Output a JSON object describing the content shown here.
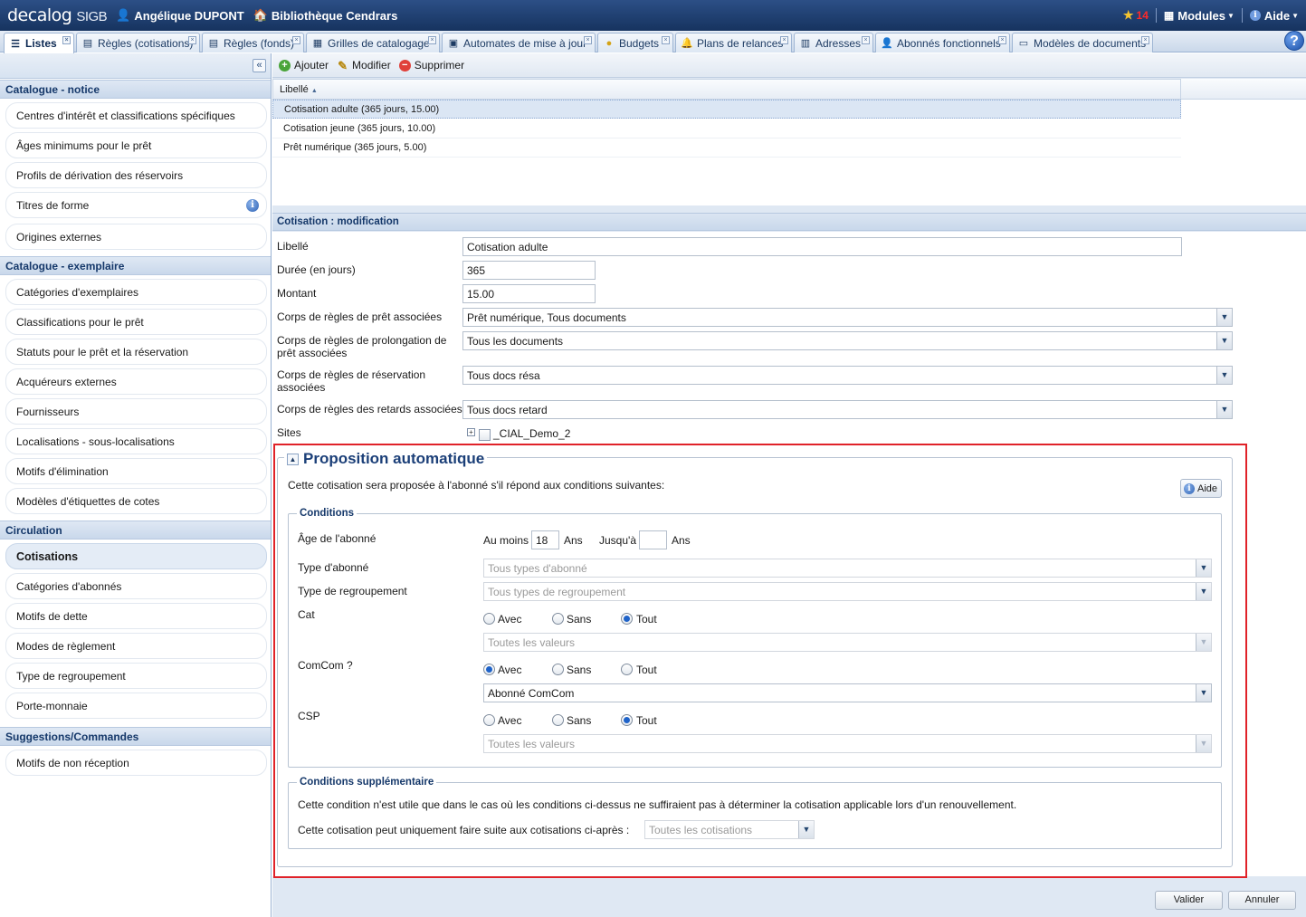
{
  "app": {
    "logo": "decalog",
    "product": "SIGB"
  },
  "user": {
    "name": "Angélique DUPONT",
    "library": "Bibliothèque Cendrars"
  },
  "topright": {
    "notifications": "14",
    "modules": "Modules",
    "aide": "Aide"
  },
  "tabs": [
    {
      "label": "Listes"
    },
    {
      "label": "Règles (cotisations)"
    },
    {
      "label": "Règles (fonds)"
    },
    {
      "label": "Grilles de catalogage"
    },
    {
      "label": "Automates de mise à jour"
    },
    {
      "label": "Budgets"
    },
    {
      "label": "Plans de relances"
    },
    {
      "label": "Adresses"
    },
    {
      "label": "Abonnés fonctionnels"
    },
    {
      "label": "Modèles de documents"
    }
  ],
  "sidebar": {
    "sections": [
      {
        "title": "Catalogue - notice",
        "items": [
          "Centres d'intérêt et classifications spécifiques",
          "Âges minimums pour le prêt",
          "Profils de dérivation des réservoirs",
          "Titres de forme",
          "Origines externes"
        ]
      },
      {
        "title": "Catalogue - exemplaire",
        "items": [
          "Catégories d'exemplaires",
          "Classifications pour le prêt",
          "Statuts pour le prêt et la réservation",
          "Acquéreurs externes",
          "Fournisseurs",
          "Localisations - sous-localisations",
          "Motifs d'élimination",
          "Modèles d'étiquettes de cotes"
        ]
      },
      {
        "title": "Circulation",
        "items": [
          "Cotisations",
          "Catégories d'abonnés",
          "Motifs de dette",
          "Modes de règlement",
          "Type de regroupement",
          "Porte-monnaie"
        ]
      },
      {
        "title": "Suggestions/Commandes",
        "items": [
          "Motifs de non réception"
        ]
      }
    ],
    "selected": "Cotisations"
  },
  "toolbar": {
    "add": "Ajouter",
    "edit": "Modifier",
    "delete": "Supprimer"
  },
  "grid": {
    "column": "Libellé",
    "rows": [
      "Cotisation adulte (365 jours, 15.00)",
      "Cotisation jeune (365 jours, 10.00)",
      "Prêt numérique (365 jours, 5.00)"
    ]
  },
  "form": {
    "title": "Cotisation : modification",
    "libelle_label": "Libellé",
    "libelle_value": "Cotisation adulte",
    "duree_label": "Durée (en jours)",
    "duree_value": "365",
    "montant_label": "Montant",
    "montant_value": "15.00",
    "pret_label": "Corps de règles de prêt associées",
    "pret_value": "Prêt numérique, Tous documents",
    "prolong_label_1": "Corps de règles de prolongation de",
    "prolong_label_2": "prêt associées",
    "prolong_value": "Tous les documents",
    "resa_label_1": "Corps de règles de réservation",
    "resa_label_2": "associées",
    "resa_value": "Tous docs résa",
    "retard_label": "Corps de règles des retards associées",
    "retard_value": "Tous docs retard",
    "sites_label": "Sites",
    "site_value": "_CIAL_Demo_2"
  },
  "proposition": {
    "title": "Proposition automatique",
    "intro": "Cette cotisation sera proposée à l'abonné s'il répond aux conditions suivantes:",
    "aide": "Aide",
    "conditions_title": "Conditions",
    "age_label": "Âge de l'abonné",
    "au_moins": "Au moins",
    "age_min": "18",
    "ans": "Ans",
    "jusqua": "Jusqu'à",
    "age_max": "",
    "type_abonne_label": "Type d'abonné",
    "type_abonne_placeholder": "Tous types d'abonné",
    "type_regroupement_label": "Type de regroupement",
    "type_regroupement_placeholder": "Tous types de regroupement",
    "avec": "Avec",
    "sans": "Sans",
    "tout": "Tout",
    "cat_label": "Cat",
    "cat_selected": "Tout",
    "cat_values": "Toutes les valeurs",
    "comcom_label": "ComCom ?",
    "comcom_selected": "Avec",
    "comcom_value": "Abonné ComCom",
    "csp_label": "CSP",
    "csp_selected": "Tout",
    "csp_values": "Toutes les valeurs",
    "supp_title": "Conditions supplémentaire",
    "supp_text": "Cette condition n'est utile que dans le cas où les conditions ci-dessus ne suffiraient pas à déterminer la cotisation applicable lors d'un renouvellement.",
    "supp_label": "Cette cotisation peut uniquement faire suite aux cotisations ci-après :",
    "supp_value": "Toutes les cotisations"
  },
  "footer": {
    "validate": "Valider",
    "cancel": "Annuler"
  }
}
